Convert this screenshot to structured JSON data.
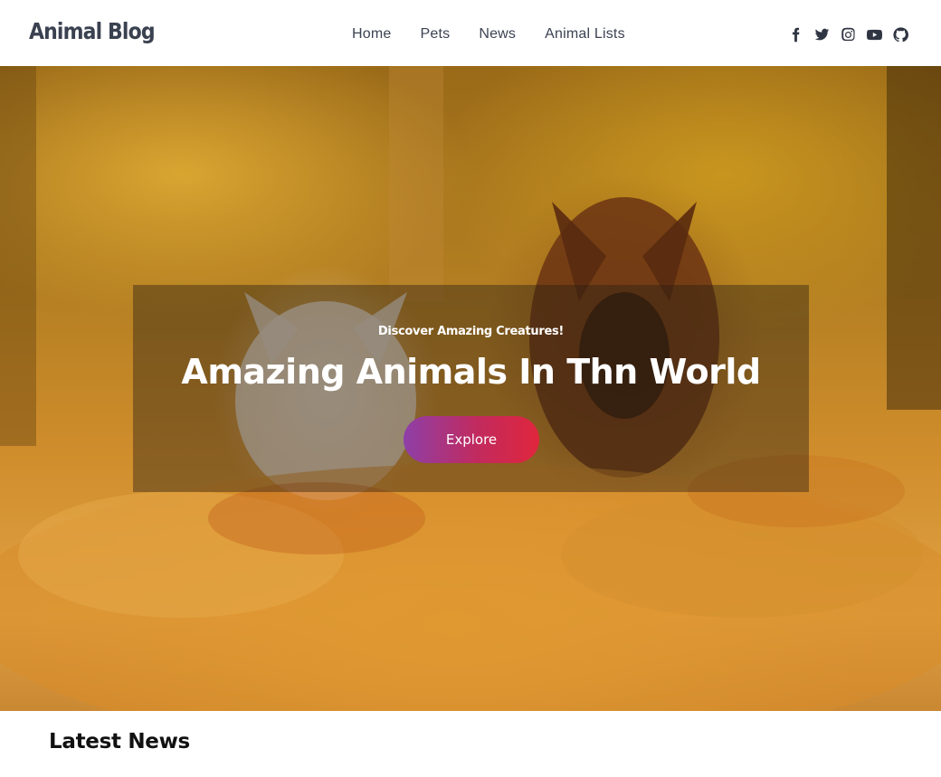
{
  "header": {
    "logo": "Animal Blog",
    "nav": [
      {
        "label": "Home"
      },
      {
        "label": "Pets"
      },
      {
        "label": "News"
      },
      {
        "label": "Animal Lists"
      }
    ],
    "social_icons": [
      "facebook-icon",
      "twitter-icon",
      "instagram-icon",
      "youtube-icon",
      "github-icon"
    ]
  },
  "hero": {
    "subtitle": "Discover Amazing Creatures!",
    "title": "Amazing Animals In Thn World",
    "button_label": "Explore",
    "button_gradient": [
      "#8e3fa8",
      "#c22a5d",
      "#e0263d"
    ],
    "background_description_colors": [
      "#9a6a18",
      "#e0a244"
    ]
  },
  "latest": {
    "title": "Latest News"
  }
}
